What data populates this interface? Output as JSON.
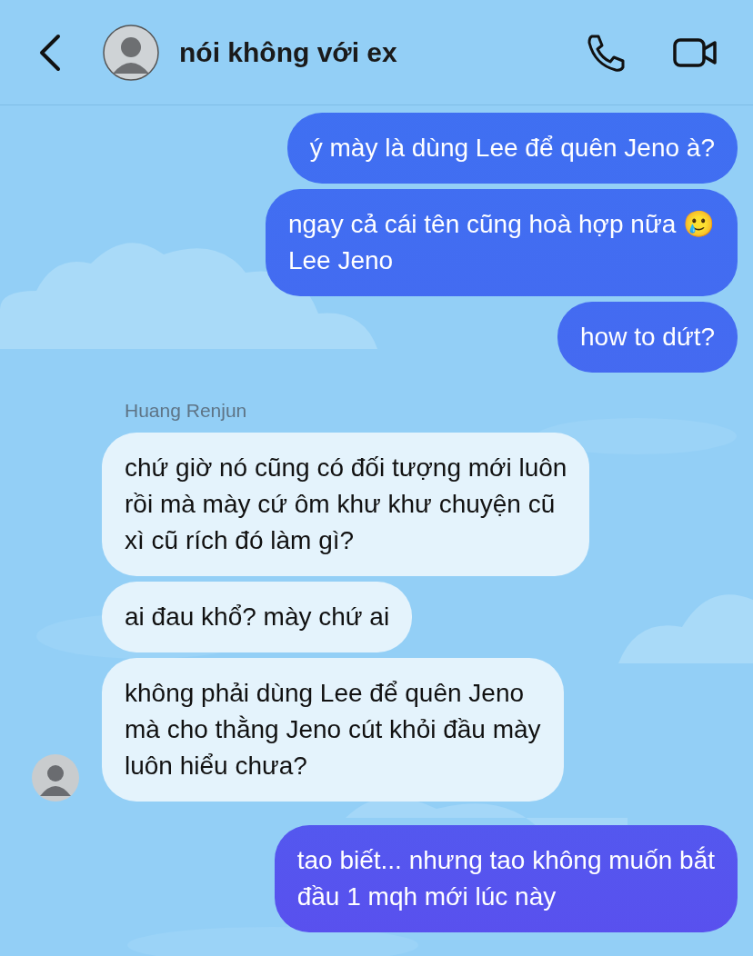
{
  "header": {
    "title": "nói không với ex"
  },
  "messages": [
    {
      "kind": "outgoing",
      "text": "ý mày là dùng Lee để quên Jeno à?"
    },
    {
      "kind": "outgoing",
      "text": "ngay cả cái tên cũng hoà hợp nữa 🥲\nLee Jeno"
    },
    {
      "kind": "outgoing",
      "text": "how to dứt?"
    },
    {
      "kind": "sender",
      "text": "Huang Renjun"
    },
    {
      "kind": "incoming",
      "text": "chứ giờ nó cũng có đối tượng mới luôn\nrồi mà mày cứ ôm khư khư chuyện cũ\nxì cũ rích đó làm gì?",
      "avatar": false
    },
    {
      "kind": "incoming",
      "text": "ai đau khổ? mày chứ ai",
      "avatar": false
    },
    {
      "kind": "incoming",
      "text": "không phải dùng Lee để quên Jeno\nmà cho thằng Jeno cút khỏi đầu mày\nluôn hiểu chưa?",
      "avatar": true
    },
    {
      "kind": "outgoing",
      "text": "tao biết... nhưng tao không muốn bắt\nđầu 1 mqh mới lúc này"
    }
  ]
}
